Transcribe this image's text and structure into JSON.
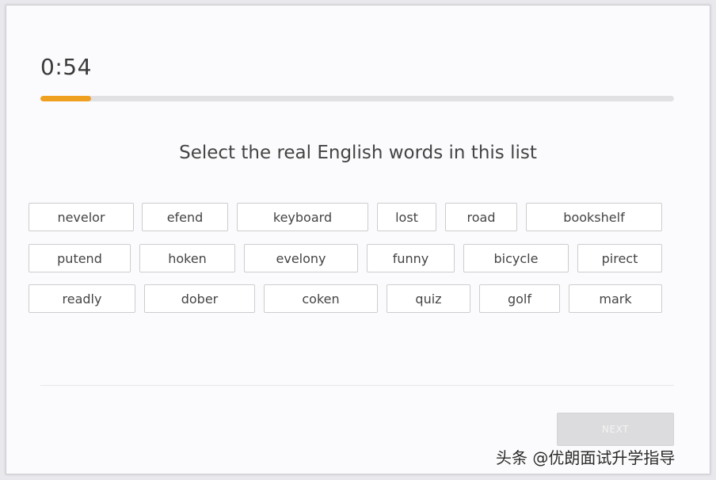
{
  "timer": {
    "text": "0:54",
    "progress_fraction": 0.08
  },
  "colors": {
    "progress_fill": "#f0a020",
    "progress_track": "#e1e1e4"
  },
  "prompt": "Select the real English words in this list",
  "words": [
    "nevelor",
    "efend",
    "keyboard",
    "lost",
    "road",
    "bookshelf",
    "putend",
    "hoken",
    "evelony",
    "funny",
    "bicycle",
    "pirect",
    "readly",
    "dober",
    "coken",
    "quiz",
    "golf",
    "mark"
  ],
  "next_button": {
    "label": "NEXT",
    "enabled": false
  },
  "watermark": "头条 @优朗面试升学指导"
}
